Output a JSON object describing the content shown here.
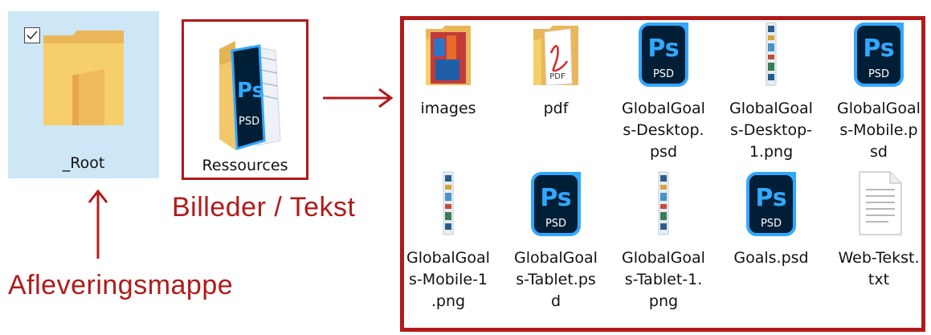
{
  "left": {
    "root_folder_label": "_Root",
    "resources_folder_label": "Ressources",
    "resources_caption": "Billeder / Tekst",
    "delivery_caption": "Afleveringsmappe"
  },
  "files": [
    {
      "label": "images",
      "icon": "folder-images-icon"
    },
    {
      "label": "pdf",
      "icon": "folder-pdf-icon"
    },
    {
      "label": "GlobalGoal\ns-Desktop.\npsd",
      "icon": "photoshop-file-icon"
    },
    {
      "label": "GlobalGoal\ns-Desktop-\n1.png",
      "icon": "image-file-icon"
    },
    {
      "label": "GlobalGoal\ns-Mobile.p\nsd",
      "icon": "photoshop-file-icon"
    },
    {
      "label": "GlobalGoal\ns-Mobile-1\n.png",
      "icon": "image-file-icon"
    },
    {
      "label": "GlobalGoal\ns-Tablet.ps\nd",
      "icon": "photoshop-file-icon"
    },
    {
      "label": "GlobalGoal\ns-Tablet-1.\npng",
      "icon": "image-file-icon"
    },
    {
      "label": "Goals.psd",
      "icon": "photoshop-file-icon"
    },
    {
      "label": "Web-Tekst.\ntxt",
      "icon": "text-file-icon"
    }
  ],
  "icon_text": {
    "ps": "Ps",
    "psd": "PSD",
    "pdf": "PDF"
  },
  "colors": {
    "accent_red": "#b11a1a",
    "selection_blue": "#cde7f7",
    "folder_yellow": "#f6cf6b",
    "ps_blue": "#31a8ff",
    "ps_dark": "#001e36"
  }
}
